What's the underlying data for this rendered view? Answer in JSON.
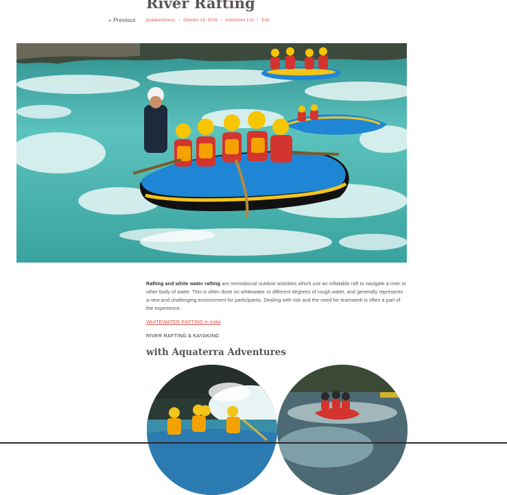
{
  "nav": {
    "previous_label": "« Previous"
  },
  "post": {
    "title": "River Rafting",
    "meta": {
      "author": "goadventures1",
      "date": "October 19, 2018",
      "category": "Adventure List",
      "edit": "Edit"
    },
    "hero_image": "river-rafting-hero",
    "intro_bold": "Rafting and white water rafting",
    "intro_rest": " are recreational outdoor activities which use an inflatable raft to navigate a river or other body of water. This is often done on whitewater or different degrees of rough water, and generally represents a new and challenging environment for participants. Dealing with risk and the need for teamwork is often a part of the experience.",
    "link_text": "WHITEWATER RAFTING in India",
    "caps_line": "RIVER RAFTING & KAYAKING",
    "subheading": "with Aquaterra Adventures"
  },
  "colors": {
    "accent": "#d9534f",
    "title": "#5b5656",
    "water": "#49b2ae",
    "raft_blue": "#1f86d6",
    "raft_yellow": "#f3c51a"
  }
}
